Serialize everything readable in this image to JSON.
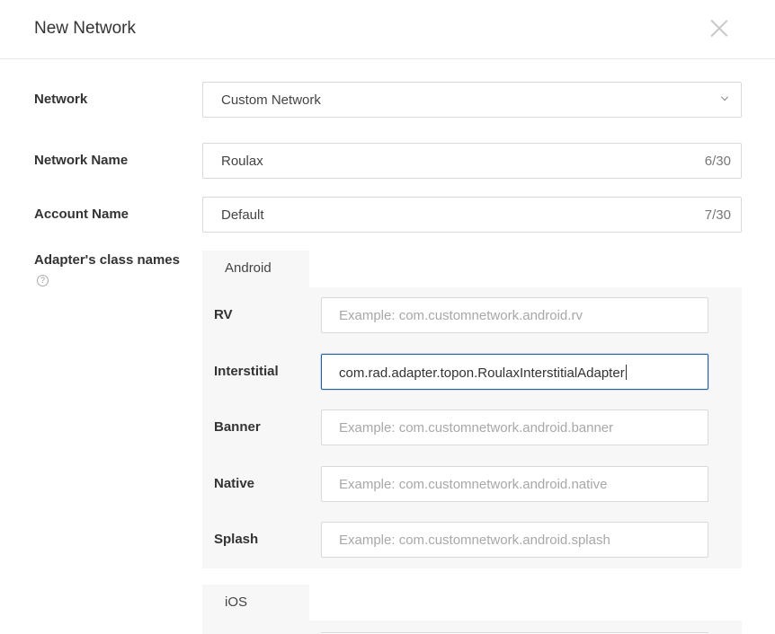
{
  "dialog": {
    "title": "New Network"
  },
  "form": {
    "network": {
      "label": "Network",
      "value": "Custom Network"
    },
    "network_name": {
      "label": "Network Name",
      "value": "Roulax",
      "count": "6/30"
    },
    "account_name": {
      "label": "Account Name",
      "value": "Default",
      "count": "7/30"
    },
    "adapters": {
      "label": "Adapter's class names"
    }
  },
  "platforms": {
    "android": {
      "tab": "Android",
      "rows": {
        "rv": {
          "label": "RV",
          "placeholder": "Example: com.customnetwork.android.rv"
        },
        "interstitial": {
          "label": "Interstitial",
          "value": "com.rad.adapter.topon.RoulaxInterstitialAdapter"
        },
        "banner": {
          "label": "Banner",
          "placeholder": "Example: com.customnetwork.android.banner"
        },
        "native": {
          "label": "Native",
          "placeholder": "Example: com.customnetwork.android.native"
        },
        "splash": {
          "label": "Splash",
          "placeholder": "Example: com.customnetwork.android.splash"
        }
      }
    },
    "ios": {
      "tab": "iOS"
    }
  },
  "icons": {
    "close": "close-icon",
    "dropdown": "chevron-down-icon",
    "help": "help-circle-icon"
  },
  "colors": {
    "focus_border": "#1f5fa8",
    "panel_bg": "#f7f7f7"
  }
}
